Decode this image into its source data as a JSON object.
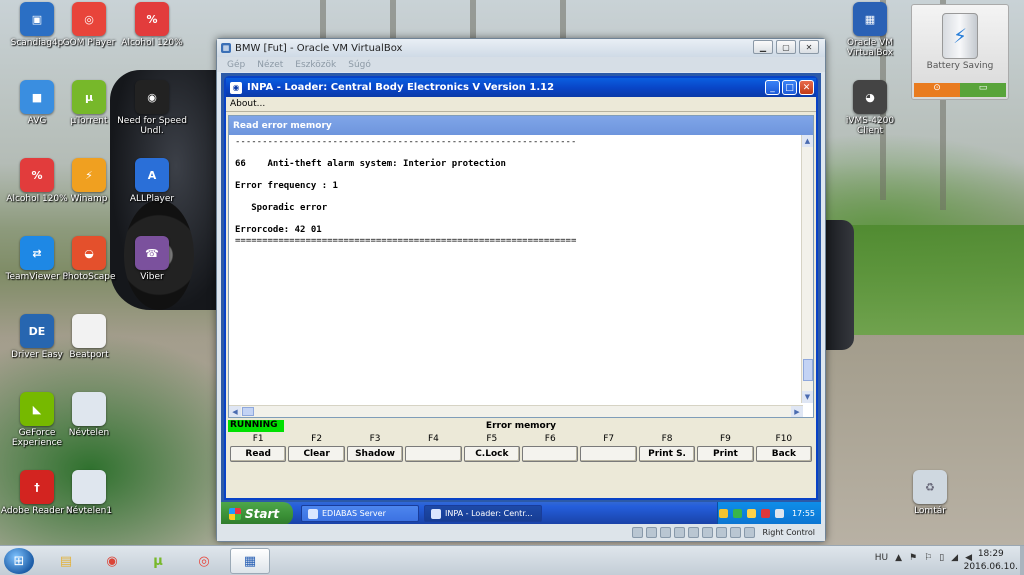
{
  "desktop": {
    "icons": [
      {
        "label": "Scandiag4p",
        "icon": "scandiag-icon",
        "color": "#2b6fc4",
        "glyph": "▣"
      },
      {
        "label": "GOM Player",
        "icon": "gom-player-icon",
        "color": "#e8443a",
        "glyph": "◎"
      },
      {
        "label": "Alcohol 120%",
        "icon": "alcohol-icon",
        "color": "#e23c3c",
        "glyph": "%"
      },
      {
        "label": "AVG",
        "icon": "avg-icon",
        "color": "#3a8ee0",
        "glyph": "■"
      },
      {
        "label": "µTorrent",
        "icon": "utorrent-icon",
        "color": "#77b82a",
        "glyph": "µ"
      },
      {
        "label": "Need for Speed Undl.",
        "icon": "nfs-icon",
        "color": "#222222",
        "glyph": "◉"
      },
      {
        "label": "Alcohol 120%",
        "icon": "alcohol-icon",
        "color": "#e23c3c",
        "glyph": "%"
      },
      {
        "label": "Winamp",
        "icon": "winamp-icon",
        "color": "#f0a020",
        "glyph": "⚡"
      },
      {
        "label": "ALLPlayer",
        "icon": "allplayer-icon",
        "color": "#2a6fd8",
        "glyph": "A"
      },
      {
        "label": "TeamViewer 9",
        "icon": "teamviewer-icon",
        "color": "#1e88e5",
        "glyph": "⇄"
      },
      {
        "label": "PhotoScape",
        "icon": "photoscape-icon",
        "color": "#e4502c",
        "glyph": "◒"
      },
      {
        "label": "Viber",
        "icon": "viber-icon",
        "color": "#7b519d",
        "glyph": "☎"
      },
      {
        "label": "Driver Easy",
        "icon": "drivereasy-icon",
        "color": "#2766b0",
        "glyph": "DE"
      },
      {
        "label": "Beatport",
        "icon": "document-icon",
        "color": "#f2f2f2",
        "glyph": ""
      },
      {
        "label": "GeForce Experience",
        "icon": "geforce-icon",
        "color": "#76b900",
        "glyph": "◣"
      },
      {
        "label": "Névtelen",
        "icon": "window-icon",
        "color": "#dfe6ee",
        "glyph": ""
      },
      {
        "label": "Adobe Reader X",
        "icon": "adobe-reader-icon",
        "color": "#d32420",
        "glyph": "†"
      },
      {
        "label": "Névtelen1",
        "icon": "window-icon",
        "color": "#dfe6ee",
        "glyph": ""
      },
      {
        "label": "Oracle VM VirtualBox",
        "icon": "virtualbox-icon",
        "color": "#2a61b5",
        "glyph": "▦"
      },
      {
        "label": "iVMS-4200 Client",
        "icon": "ivms-icon",
        "color": "#444444",
        "glyph": "◕"
      },
      {
        "label": "Lomtár",
        "icon": "recycle-bin-icon",
        "color": "#cfd8e0",
        "glyph": "♻"
      }
    ],
    "battery_widget": {
      "label": "Battery Saving"
    }
  },
  "host_taskbar": {
    "language": "HU",
    "time": "18:29",
    "date": "2016.06.10.",
    "pinned": [
      {
        "icon": "folder-icon",
        "glyph": "▤",
        "color": "#e3b23c"
      },
      {
        "icon": "chrome-icon",
        "glyph": "◉",
        "color": "#db4437"
      },
      {
        "icon": "utorrent-icon",
        "glyph": "µ",
        "color": "#77b82a"
      },
      {
        "icon": "gom-player-icon",
        "glyph": "◎",
        "color": "#e8443a"
      },
      {
        "icon": "virtualbox-icon",
        "glyph": "▦",
        "color": "#2a61b5"
      }
    ]
  },
  "vbox": {
    "title": "BMW [Fut] - Oracle VM VirtualBox",
    "menu": [
      "Gép",
      "Nézet",
      "Eszközök",
      "Súgó"
    ],
    "host_key": "Right Control"
  },
  "inpa": {
    "title": "INPA - Loader:  Central Body Electronics V Version 1.12",
    "menu_about": "About...",
    "ecu_title": "Read error memory",
    "content": {
      "separator_top": "---------------------------------------------------------------",
      "error_code_line": "66    Anti-theft alarm system: Interior protection",
      "frequency_line": "Error frequency : 1",
      "sporadic_line": "   Sporadic error",
      "errorcode_line": "Errorcode: 42 01",
      "separator_bottom": "==============================================================="
    },
    "status": "RUNNING",
    "status_title": "Error memory",
    "fkeys": [
      {
        "key": "F1",
        "label": "Read"
      },
      {
        "key": "F2",
        "label": "Clear"
      },
      {
        "key": "F3",
        "label": "Shadow"
      },
      {
        "key": "F4",
        "label": ""
      },
      {
        "key": "F5",
        "label": "C.Lock"
      },
      {
        "key": "F6",
        "label": ""
      },
      {
        "key": "F7",
        "label": ""
      },
      {
        "key": "F8",
        "label": "Print S."
      },
      {
        "key": "F9",
        "label": "Print"
      },
      {
        "key": "F10",
        "label": "Back"
      }
    ]
  },
  "xp_taskbar": {
    "start_label": "Start",
    "tasks": [
      "EDIABAS Server",
      "INPA - Loader:  Centr..."
    ],
    "clock": "17:55"
  },
  "colors": {
    "running_green": "#00e000",
    "xp_blue": "#245edb",
    "inpa_title_blue": "#0946c8"
  }
}
